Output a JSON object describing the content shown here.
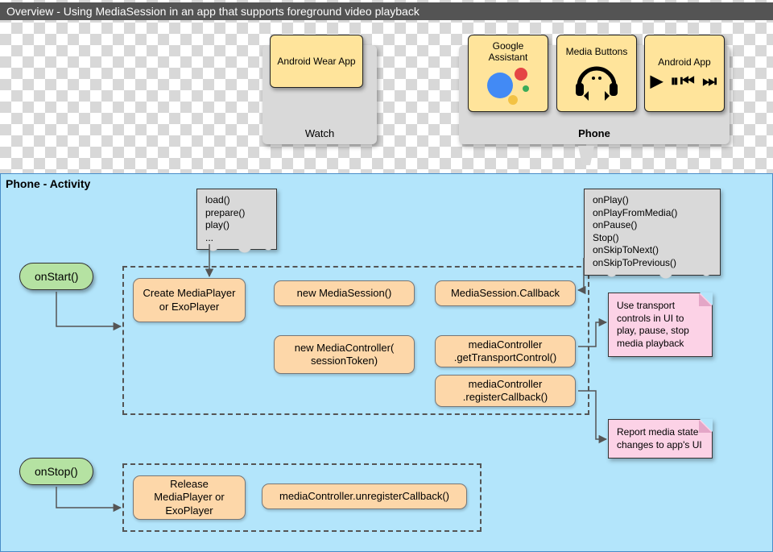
{
  "title": "Overview - Using MediaSession in an app that supports foreground video playback",
  "devices": {
    "watch": {
      "label": "Watch",
      "card": "Android Wear App"
    },
    "phone": {
      "label": "Phone",
      "cards": {
        "assistant": "Google Assistant",
        "mediaButtons": "Media Buttons",
        "androidApp": "Android App"
      }
    }
  },
  "activity": {
    "title": "Phone - Activity",
    "pills": {
      "start": "onStart()",
      "stop": "onStop()"
    },
    "boxes": {
      "create": "Create MediaPlayer or ExoPlayer",
      "newSession": "new MediaSession()",
      "callback": "MediaSession.Callback",
      "newController": "new MediaController( sessionToken)",
      "getTransport": "mediaController .getTransportControl()",
      "registerCb": "mediaController .registerCallback()",
      "release": "Release MediaPlayer or ExoPlayer",
      "unregisterCb": "mediaController.unregisterCallback()"
    },
    "notes": {
      "playerOps": "load()\nprepare()\nplay()\n...",
      "callbacks": "onPlay()\nonPlayFromMedia()\nonPause()\nStop()\nonSkipToNext()\nonSkipToPrevious()"
    },
    "stickies": {
      "transport": "Use transport controls in UI to play, pause, stop media playback",
      "report": "Report media state changes to app's UI"
    }
  },
  "chart_data": {
    "type": "diagram",
    "title": "Overview - Using MediaSession in an app that supports foreground video playback",
    "clusters": [
      {
        "id": "watch",
        "label": "Watch",
        "nodes": [
          "wear-app"
        ]
      },
      {
        "id": "phone-device",
        "label": "Phone",
        "nodes": [
          "google-assistant",
          "media-buttons",
          "android-app"
        ]
      },
      {
        "id": "phone-activity",
        "label": "Phone - Activity",
        "nodes": [
          "onStart",
          "onStop",
          "create-player",
          "new-mediasession",
          "mediasession-callback",
          "new-mediacontroller",
          "get-transport",
          "register-callback",
          "release-player",
          "unregister-callback"
        ],
        "subclusters": [
          {
            "id": "onstart-group",
            "nodes": [
              "create-player",
              "new-mediasession",
              "mediasession-callback",
              "new-mediacontroller",
              "get-transport",
              "register-callback"
            ]
          },
          {
            "id": "onstop-group",
            "nodes": [
              "release-player",
              "unregister-callback"
            ]
          }
        ]
      }
    ],
    "nodes": [
      {
        "id": "wear-app",
        "label": "Android Wear App"
      },
      {
        "id": "google-assistant",
        "label": "Google Assistant"
      },
      {
        "id": "media-buttons",
        "label": "Media Buttons"
      },
      {
        "id": "android-app",
        "label": "Android App"
      },
      {
        "id": "onStart",
        "label": "onStart()"
      },
      {
        "id": "onStop",
        "label": "onStop()"
      },
      {
        "id": "create-player",
        "label": "Create MediaPlayer or ExoPlayer"
      },
      {
        "id": "new-mediasession",
        "label": "new MediaSession()"
      },
      {
        "id": "mediasession-callback",
        "label": "MediaSession.Callback"
      },
      {
        "id": "new-mediacontroller",
        "label": "new MediaController(sessionToken)"
      },
      {
        "id": "get-transport",
        "label": "mediaController.getTransportControl()"
      },
      {
        "id": "register-callback",
        "label": "mediaController.registerCallback()"
      },
      {
        "id": "release-player",
        "label": "Release MediaPlayer or ExoPlayer"
      },
      {
        "id": "unregister-callback",
        "label": "mediaController.unregisterCallback()"
      },
      {
        "id": "note-player-ops",
        "label": "load() prepare() play() ...",
        "type": "note"
      },
      {
        "id": "note-callbacks",
        "label": "onPlay() onPlayFromMedia() onPause() onStop() onSkipToNext() onSkipToPrevious()",
        "type": "note"
      },
      {
        "id": "sticky-transport",
        "label": "Use transport controls in UI to play, pause, stop media playback",
        "type": "sticky"
      },
      {
        "id": "sticky-report",
        "label": "Report media state changes to app's UI",
        "type": "sticky"
      }
    ],
    "edges": [
      {
        "from": "phone-device",
        "to": "phone-activity"
      },
      {
        "from": "onStart",
        "to": "onstart-group"
      },
      {
        "from": "onStop",
        "to": "onstop-group"
      },
      {
        "from": "note-player-ops",
        "to": "create-player"
      },
      {
        "from": "note-callbacks",
        "to": "mediasession-callback"
      },
      {
        "from": "get-transport",
        "to": "sticky-transport"
      },
      {
        "from": "register-callback",
        "to": "sticky-report"
      }
    ]
  }
}
